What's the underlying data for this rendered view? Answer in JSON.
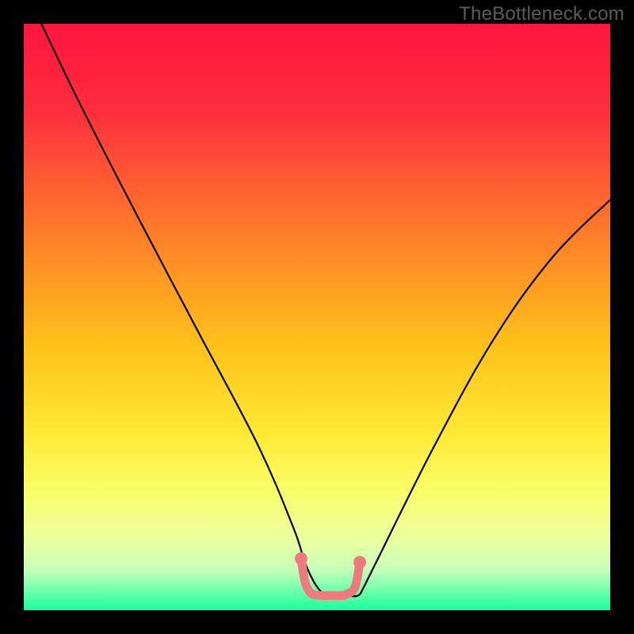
{
  "watermark": "TheBottleneck.com",
  "chart_data": {
    "type": "line",
    "title": "",
    "xlabel": "",
    "ylabel": "",
    "xlim": [
      0,
      100
    ],
    "ylim": [
      0,
      100
    ],
    "grid": false,
    "annotations": [],
    "background_gradient": {
      "stops": [
        {
          "pos": 0,
          "color": "#ff153f"
        },
        {
          "pos": 15,
          "color": "#ff2e3d"
        },
        {
          "pos": 35,
          "color": "#ff7a2a"
        },
        {
          "pos": 55,
          "color": "#ffc21a"
        },
        {
          "pos": 70,
          "color": "#ffe935"
        },
        {
          "pos": 80,
          "color": "#f8ff6a"
        },
        {
          "pos": 88,
          "color": "#ecffa0"
        },
        {
          "pos": 93,
          "color": "#c6ffb9"
        },
        {
          "pos": 96,
          "color": "#7effb0"
        },
        {
          "pos": 100,
          "color": "#19ff9b"
        }
      ]
    },
    "series": [
      {
        "name": "curve",
        "color": "#000000",
        "x": [
          3,
          10,
          20,
          30,
          40,
          46,
          48,
          50,
          52,
          55,
          57,
          58,
          60,
          70,
          80,
          90,
          100
        ],
        "y": [
          100,
          85.5,
          66,
          47,
          28,
          14,
          8,
          4,
          2.5,
          2.5,
          2.5,
          4,
          8,
          28,
          46,
          60,
          70
        ]
      },
      {
        "name": "bottom-highlight",
        "color": "#ee7b7b",
        "x": [
          47.3,
          48,
          49,
          50,
          51,
          52,
          53,
          54,
          55,
          56.5,
          57.3
        ],
        "y": [
          8.8,
          4.7,
          2.9,
          2.6,
          2.5,
          2.5,
          2.5,
          2.5,
          2.7,
          4.0,
          8.2
        ]
      }
    ],
    "markers": [
      {
        "name": "left-dot",
        "x": 47.3,
        "y": 8.8,
        "color": "#ee7b7b"
      },
      {
        "name": "right-dot",
        "x": 57.3,
        "y": 8.2,
        "color": "#ee7b7b"
      }
    ]
  }
}
